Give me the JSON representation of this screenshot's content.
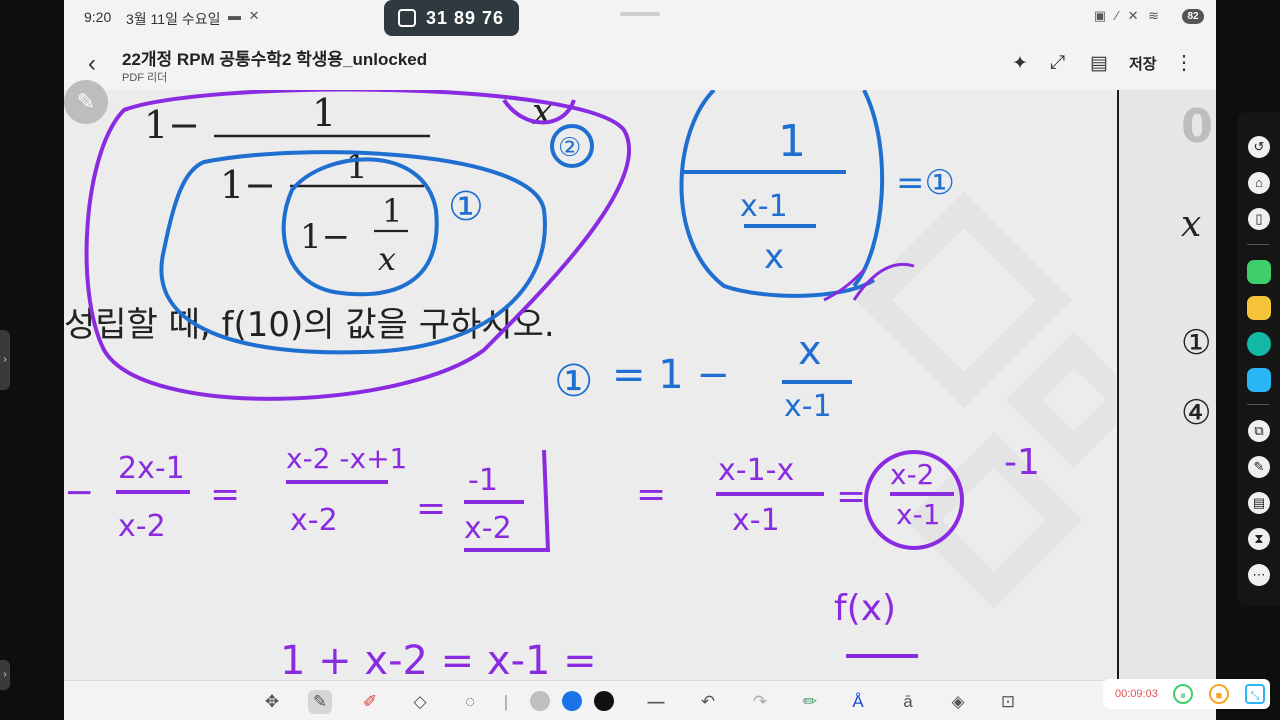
{
  "status": {
    "time": "9:20",
    "date": "3월 11일 수요일",
    "battery": "82"
  },
  "pill": {
    "code": "31 89 76"
  },
  "header": {
    "title": "22개정 RPM 공통수학2 학생용_unlocked",
    "subtitle": "PDF 리더",
    "save_label": "저장"
  },
  "document": {
    "top_numerator": "1",
    "top_one_minus": "1−",
    "mid_numerator": "1",
    "mid_one_minus": "1−",
    "inner_numerator": "1",
    "inner_one_minus": "1−",
    "inner_denominator": "x",
    "corner_var": "x",
    "question_text": "성립할 때, f(10)의 값을 구하시오."
  },
  "handwriting": {
    "circle_label_1": "①",
    "circle_label_2": "②",
    "frac_top": "1",
    "frac_mid": "x-1",
    "frac_bottom": "x",
    "eq_one": "=①",
    "step1_lhs": "①",
    "step1_eq": "= 1 −",
    "step1_num": "x",
    "step1_den": "x-1",
    "row2_neg": "−",
    "row2_a_num": "2x-1",
    "row2_a_den": "x-2",
    "row2_eq1": "=",
    "row2_b_num": "x-2 -x+1",
    "row2_b_den": "x-2",
    "row2_eq2": "=",
    "row2_c_num": "-1",
    "row2_c_den": "x-2",
    "row2_eq3": "=",
    "row2_d_num": "x-1-x",
    "row2_d_den": "x-1",
    "row2_eq4": "=",
    "row2_e_num": "x-2",
    "row2_e_den": "x-1",
    "row2_tail": "-1",
    "row3": "1 + x-2  =  x-1  =",
    "row3_f": "f(x)"
  },
  "page2": {
    "big": "0",
    "var": "x",
    "opt1": "①",
    "opt4": "④"
  },
  "recording": {
    "time": "00:09:03"
  },
  "colors": {
    "pen_blue": "#1f6fd1",
    "pen_purple": "#8a2be2",
    "accent": "#1a73e8",
    "rec_red": "#e05050"
  }
}
